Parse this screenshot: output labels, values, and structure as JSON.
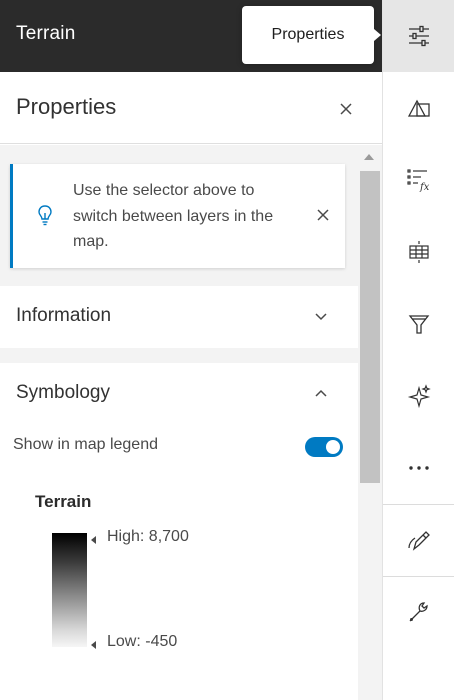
{
  "header": {
    "title": "Terrain"
  },
  "tooltip": {
    "text": "Properties"
  },
  "actionbar": {
    "items": [
      {
        "icon": "properties-sliders-icon",
        "active": true
      },
      {
        "icon": "styles-shapes-icon"
      },
      {
        "icon": "fields-fx-icon"
      },
      {
        "icon": "raster-functions-icon"
      },
      {
        "icon": "filter-icon"
      },
      {
        "icon": "effects-sparkle-icon"
      },
      {
        "icon": "more-ellipsis-icon"
      },
      {
        "icon": "sketch-pen-icon"
      },
      {
        "icon": "wrench-icon"
      }
    ]
  },
  "panel": {
    "title": "Properties",
    "notice": {
      "text": "Use the selector above to switch between layers in the map."
    },
    "information": {
      "title": "Information"
    },
    "symbology": {
      "title": "Symbology",
      "legend_toggle_label": "Show in map legend",
      "legend_toggle_on": true,
      "legend": {
        "title": "Terrain",
        "high_label": "High: 8,700",
        "low_label": "Low: -450"
      }
    }
  },
  "colors": {
    "header_bg": "#2b2b2b",
    "accent": "#007ac2",
    "panel_bg": "#f3f3f3"
  }
}
